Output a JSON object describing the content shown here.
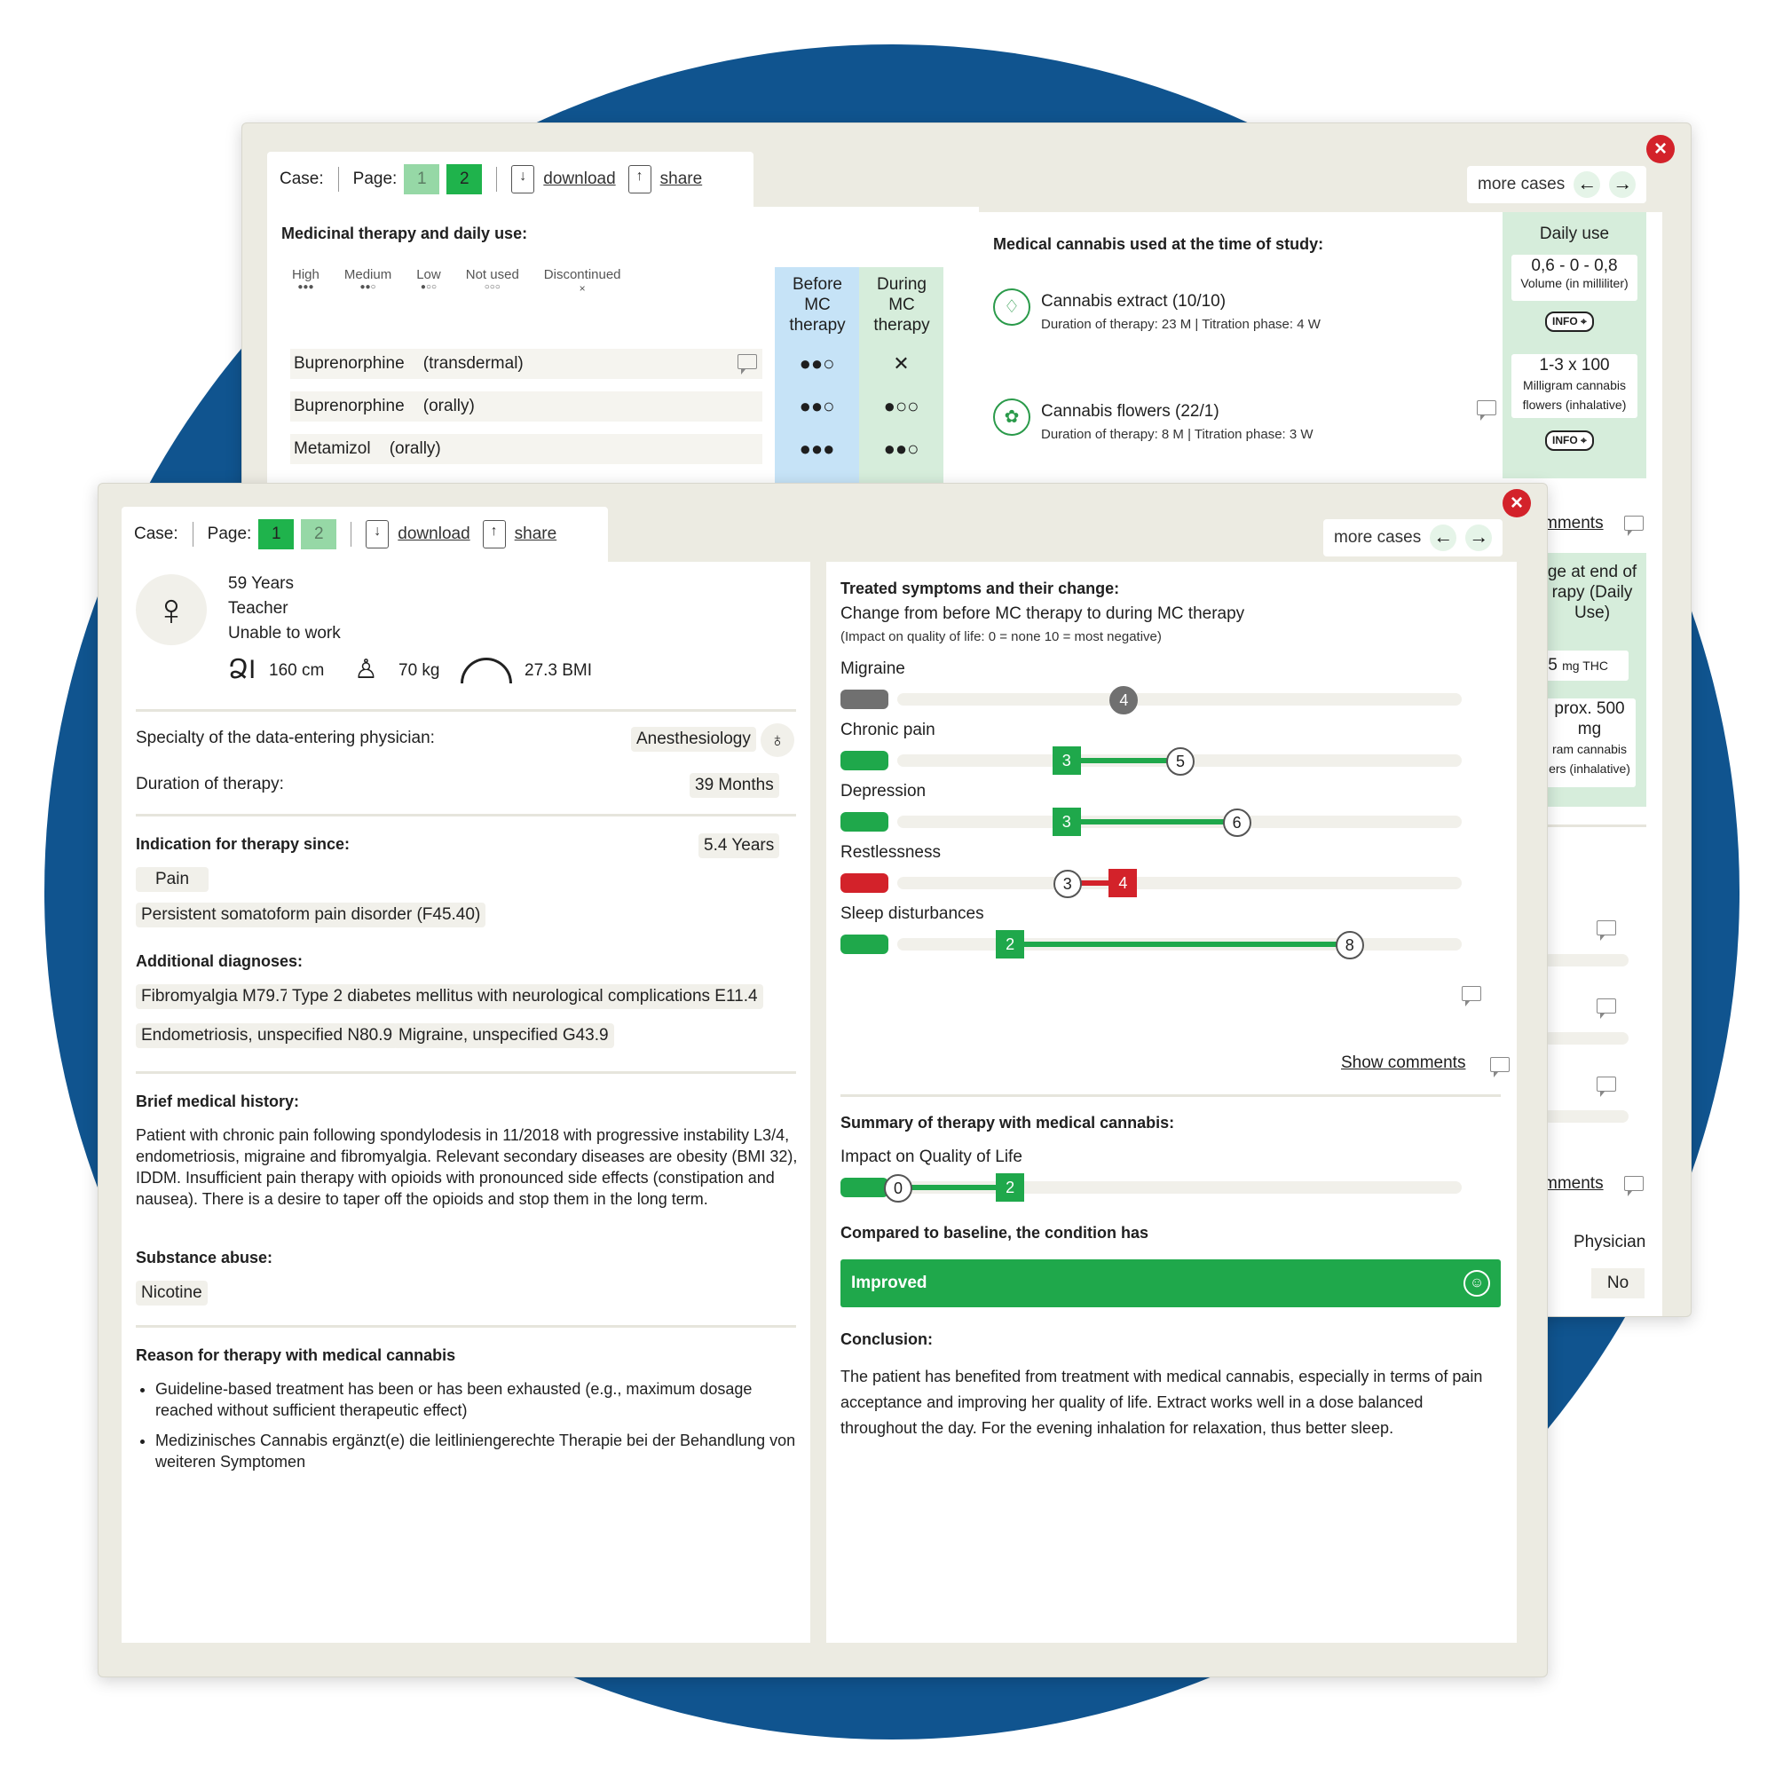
{
  "colors": {
    "circle": "#10548f",
    "green": "#1fa84b",
    "red": "#d3222a",
    "grey": "#707070",
    "before_col": "#c6e3f7",
    "during_col": "#d6eddb"
  },
  "back_window": {
    "toolbar": {
      "case_label": "Case:",
      "page_label": "Page:",
      "page1": "1",
      "page2": "2",
      "download": "download",
      "share": "share"
    },
    "more_cases": "more cases",
    "therapy_title": "Medicinal therapy and daily use:",
    "legend": [
      {
        "label": "High",
        "dots": "●●●"
      },
      {
        "label": "Medium",
        "dots": "●●○"
      },
      {
        "label": "Low",
        "dots": "●○○"
      },
      {
        "label": "Not used",
        "dots": "○○○"
      },
      {
        "label": "Discontinued",
        "dots": "×"
      }
    ],
    "before_header": "Before MC therapy",
    "during_header": "During MC therapy",
    "drugs": [
      {
        "name": "Buprenorphine",
        "route": "(transdermal)",
        "before": "●●○",
        "during": "✕"
      },
      {
        "name": "Buprenorphine",
        "route": "(orally)",
        "before": "●●○",
        "during": "●○○"
      },
      {
        "name": "Metamizol",
        "route": "(orally)",
        "before": "●●●",
        "during": "●●○"
      }
    ],
    "cannabis_title": "Medical cannabis used at the time of study:",
    "cannabis": [
      {
        "name": "Cannabis extract (10/10)",
        "detail": "Duration of therapy: 23 M  |  Titration phase: 4 W",
        "icon": "droplet-icon"
      },
      {
        "name": "Cannabis flowers (22/1)",
        "detail": "Duration of therapy: 8 M  |  Titration phase: 3 W",
        "icon": "cannabis-leaf-icon"
      }
    ],
    "daily_use_title": "Daily use",
    "daily_use": [
      {
        "value": "0,6 - 0 - 0,8",
        "unit": "Volume (in milliliter)"
      },
      {
        "value": "1-3 x 100",
        "unit": "Milligram cannabis flowers (inhalative)"
      }
    ],
    "info_label": "INFO",
    "comments_fragment": "mments",
    "end_fragment": "ge at end of rapy (Daily Use)",
    "thc_fragment": "5",
    "thc_unit": "mg THC",
    "prox_fragment": "prox. 500 mg",
    "prox_unit": "ram cannabis ers (inhalative)",
    "comments_fragment2": "mments",
    "physician": "Physician",
    "no_fragment": "No"
  },
  "front_window": {
    "toolbar": {
      "case_label": "Case:",
      "page_label": "Page:",
      "page1": "1",
      "page2": "2",
      "download": "download",
      "share": "share"
    },
    "more_cases": "more cases",
    "patient": {
      "age": "59 Years",
      "job": "Teacher",
      "work_status": "Unable to work",
      "height": "160 cm",
      "weight": "70 kg",
      "bmi": "27.3 BMI"
    },
    "specialty_label": "Specialty of the data-entering physician:",
    "specialty_value": "Anesthesiology",
    "duration_label": "Duration of therapy:",
    "duration_value": "39 Months",
    "indication_label": "Indication for therapy since:",
    "indication_value": "5.4 Years",
    "indication_chips": [
      "Pain",
      "Persistent somatoform pain disorder (F45.40)"
    ],
    "additional_label": "Additional diagnoses:",
    "additional": [
      "Fibromyalgia M79.7",
      "Type 2 diabetes mellitus with neurological complications E11.4",
      "Endometriosis, unspecified N80.9",
      "Migraine, unspecified G43.9"
    ],
    "history_label": "Brief medical history:",
    "history_text": "Patient with chronic pain following spondylodesis in 11/2018 with progressive instability L3/4, endometriosis, migraine and fibromyalgia. Relevant secondary diseases are obesity (BMI 32), IDDM. Insufficient pain therapy with opioids with pronounced side effects (constipation and nausea). There is a desire to taper off the opioids and stop them in the long term.",
    "substance_label": "Substance abuse:",
    "substance": "Nicotine",
    "reason_label": "Reason for therapy with medical cannabis",
    "reasons": [
      "Guideline-based treatment has been or has been exhausted (e.g., maximum dosage reached without sufficient therapeutic effect)",
      "Medizinisches Cannabis ergänzt(e) die leitliniengerechte Therapie bei der Behandlung von weiteren Symptomen"
    ],
    "symptoms_title": "Treated symptoms and their change:",
    "symptoms_sub": "Change from before MC therapy to during MC therapy",
    "symptoms_note": "(Impact on quality of life: 0 = none 10 = most negative)",
    "symptoms": [
      {
        "name": "Migraine",
        "before": 4,
        "during": 4,
        "status": "unchanged"
      },
      {
        "name": "Chronic pain",
        "before": 5,
        "during": 3,
        "status": "improved"
      },
      {
        "name": "Depression",
        "before": 6,
        "during": 3,
        "status": "improved"
      },
      {
        "name": "Restlessness",
        "before": 3,
        "during": 4,
        "status": "worsened"
      },
      {
        "name": "Sleep disturbances",
        "before": 8,
        "during": 2,
        "status": "improved"
      }
    ],
    "show_comments": "Show comments",
    "summary_title": "Summary of therapy with medical cannabis:",
    "qol_label": "Impact on Quality of Life",
    "qol": {
      "before": 0,
      "during": 2
    },
    "compared_label": "Compared to baseline, the condition has",
    "result": "Improved",
    "conclusion_label": "Conclusion:",
    "conclusion": "The patient has benefited from treatment with medical cannabis, especially in terms of pain acceptance and improving her quality of life. Extract works well in a dose balanced throughout the day. For the evening inhalation for relaxation, thus better sleep."
  }
}
